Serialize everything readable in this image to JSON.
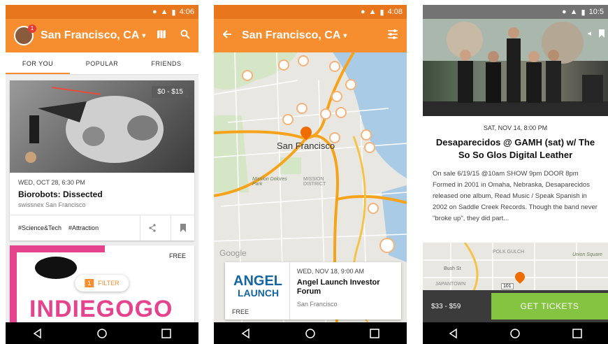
{
  "screens": [
    {
      "status_time": "4:06",
      "city": "San Francisco, CA",
      "notif_count": "1",
      "tabs": [
        "FOR YOU",
        "POPULAR",
        "FRIENDS"
      ],
      "events": [
        {
          "price": "$0 - $15",
          "date": "WED, OCT 28, 6:30 PM",
          "title": "Biorobots: Dissected",
          "venue": "swissnex San Francisco",
          "tags": [
            "#Science&Tech",
            "#Attraction"
          ]
        },
        {
          "price": "FREE",
          "brand": "INDIEGOGO"
        }
      ],
      "filter": {
        "count": "1",
        "label": "FILTER"
      }
    },
    {
      "status_time": "4:08",
      "city": "San Francisco, CA",
      "map_labels": {
        "city": "San Francisco",
        "mission_dolores": "Mission Dolores Park",
        "mission_district": "MISSION DISTRICT",
        "google": "Google"
      },
      "event": {
        "logo_top": "ANGEL",
        "logo_bottom": "LAUNCH",
        "price": "FREE",
        "date": "WED, NOV 18, 9:00 AM",
        "title": "Angel Launch Investor Forum",
        "venue": "San Francisco"
      }
    },
    {
      "status_time": "10:5",
      "date": "SAT, NOV 14, 8:00 PM",
      "title": "Desaparecidos @ GAMH (sat) w/ The So So Glos Digital Leather",
      "description": "On sale 6/19/15 @10am SHOW 9pm DOOR 8pm Formed in 2001 in Omaha, Nebraska, Desaparecidos released one album, Read Music / Speak Spanish in 2002 on Saddle Creek Records. Though the band never \"broke up\", they did part...",
      "map_labels": {
        "polk": "POLK GULCH",
        "union": "Union Square",
        "bush": "Bush St",
        "japantown": "JAPANTOWN",
        "road": "101"
      },
      "price": "$33 - $59",
      "cta": "GET TICKETS"
    }
  ],
  "colors": {
    "brand_orange": "#f68d2e",
    "status_orange": "#e8761d",
    "ticket_green": "#85c441"
  }
}
